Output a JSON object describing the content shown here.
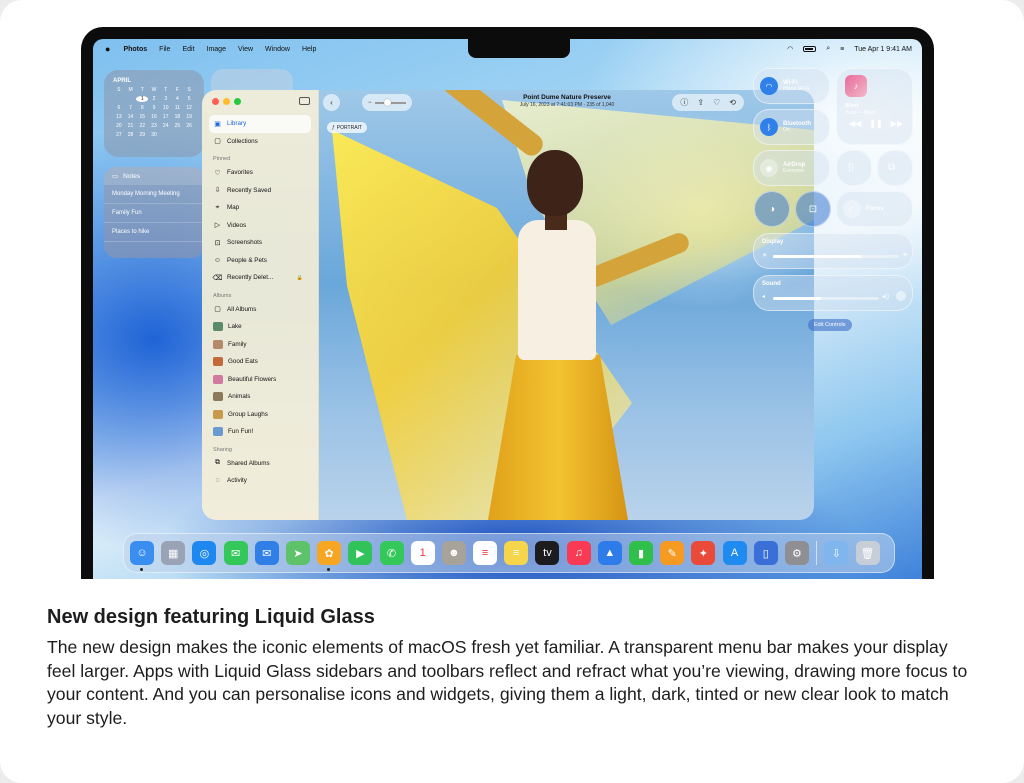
{
  "menubar": {
    "app": "Photos",
    "items": [
      "File",
      "Edit",
      "Image",
      "View",
      "Window",
      "Help"
    ],
    "datetime": "Tue Apr 1  9:41 AM"
  },
  "calendar_widget": {
    "month": "APRIL",
    "weekdays": [
      "S",
      "M",
      "T",
      "W",
      "T",
      "F",
      "S"
    ],
    "days": [
      "",
      "",
      "1",
      "2",
      "3",
      "4",
      "5",
      "6",
      "7",
      "8",
      "9",
      "10",
      "11",
      "12",
      "13",
      "14",
      "15",
      "16",
      "17",
      "18",
      "19",
      "20",
      "21",
      "22",
      "23",
      "24",
      "25",
      "26",
      "27",
      "28",
      "29",
      "30",
      "",
      "",
      ""
    ],
    "today": "1"
  },
  "notes_widget": {
    "title": "Notes",
    "items": [
      "Monday Morning Meeting",
      "Family Fun",
      "Places to hike"
    ]
  },
  "photos": {
    "title": "Point Dume Nature Preserve",
    "subtitle": "July 16, 2023 at 7:41:03 PM  ·  235 of 1,040",
    "badge": "PORTRAIT",
    "sidebar": {
      "top": [
        {
          "label": "Library",
          "icon": "library-icon"
        },
        {
          "label": "Collections",
          "icon": "collections-icon"
        }
      ],
      "pinned_header": "Pinned",
      "pinned": [
        {
          "label": "Favorites",
          "icon": "heart-icon"
        },
        {
          "label": "Recently Saved",
          "icon": "download-icon"
        },
        {
          "label": "Map",
          "icon": "map-icon"
        },
        {
          "label": "Videos",
          "icon": "video-icon"
        },
        {
          "label": "Screenshots",
          "icon": "screenshot-icon"
        },
        {
          "label": "People & Pets",
          "icon": "person-icon"
        },
        {
          "label": "Recently Delet...",
          "icon": "trash-icon"
        }
      ],
      "albums_header": "Albums",
      "albums": [
        {
          "label": "All Albums",
          "icon": "album-icon"
        },
        {
          "label": "Lake",
          "color": "#5b8a6a"
        },
        {
          "label": "Family",
          "color": "#b48a6a"
        },
        {
          "label": "Good Eats",
          "color": "#c46a3a"
        },
        {
          "label": "Beautiful Flowers",
          "color": "#d07aa0"
        },
        {
          "label": "Animals",
          "color": "#8a7a5a"
        },
        {
          "label": "Group Laughs",
          "color": "#c69a4a"
        },
        {
          "label": "Fun Fun!",
          "color": "#6a9ad0"
        }
      ],
      "sharing_header": "Sharing",
      "sharing": [
        {
          "label": "Shared Albums",
          "icon": "shared-albums-icon"
        },
        {
          "label": "Activity",
          "icon": "activity-icon"
        }
      ]
    }
  },
  "control_center": {
    "wifi": {
      "title": "Wi-Fi",
      "subtitle": "Home Wi-Fi"
    },
    "bluetooth": {
      "title": "Bluetooth",
      "subtitle": "On"
    },
    "airdrop": {
      "title": "AirDrop",
      "subtitle": "Everyone"
    },
    "now_playing": {
      "title": "Blest",
      "artist": "Yuno — Blest"
    },
    "focus": "Focus",
    "display": {
      "label": "Display",
      "level": 0.7
    },
    "sound": {
      "label": "Sound",
      "level": 0.45
    },
    "edit_controls": "Edit Controls"
  },
  "dock": {
    "apps": [
      {
        "name": "finder",
        "color": "#3a8ef0",
        "glyph": "☺"
      },
      {
        "name": "launchpad",
        "color": "#9aa3b5",
        "glyph": "▦"
      },
      {
        "name": "safari",
        "color": "#1e88f0",
        "glyph": "◎"
      },
      {
        "name": "messages",
        "color": "#34c759",
        "glyph": "✉"
      },
      {
        "name": "mail",
        "color": "#2f7fe6",
        "glyph": "✉"
      },
      {
        "name": "maps",
        "color": "#5ec26a",
        "glyph": "➤"
      },
      {
        "name": "photos",
        "color": "#f6a623",
        "glyph": "✿"
      },
      {
        "name": "facetime",
        "color": "#32c25a",
        "glyph": "▶"
      },
      {
        "name": "phone",
        "color": "#34c759",
        "glyph": "✆"
      },
      {
        "name": "calendar",
        "color": "#ffffff",
        "glyph": "1"
      },
      {
        "name": "contacts",
        "color": "#a8a39a",
        "glyph": "☻"
      },
      {
        "name": "reminders",
        "color": "#ffffff",
        "glyph": "≡"
      },
      {
        "name": "notes",
        "color": "#f7d54a",
        "glyph": "≡"
      },
      {
        "name": "tv",
        "color": "#1c1c1e",
        "glyph": "tv"
      },
      {
        "name": "music",
        "color": "#fa3a55",
        "glyph": "♫"
      },
      {
        "name": "keynote",
        "color": "#2e7bea",
        "glyph": "▲"
      },
      {
        "name": "numbers",
        "color": "#2fbf4a",
        "glyph": "▮"
      },
      {
        "name": "pages",
        "color": "#f59a23",
        "glyph": "✎"
      },
      {
        "name": "games",
        "color": "#ea4a3a",
        "glyph": "✦"
      },
      {
        "name": "app-store",
        "color": "#1f8bf0",
        "glyph": "A"
      },
      {
        "name": "iphone-mirroring",
        "color": "#3a6fd8",
        "glyph": "▯"
      },
      {
        "name": "system-settings",
        "color": "#8e8e93",
        "glyph": "⚙"
      }
    ],
    "extras": [
      {
        "name": "downloads",
        "color": "#7fb6ee",
        "glyph": "⇩"
      },
      {
        "name": "trash",
        "color": "#c7ced8",
        "glyph": "🗑"
      }
    ]
  },
  "article": {
    "headline": "New design featuring Liquid Glass",
    "body": "The new design makes the iconic elements of macOS fresh yet familiar. A transparent menu bar makes your display feel larger. Apps with Liquid Glass sidebars and toolbars reflect and refract what you’re viewing, drawing more focus to your content. And you can personalise icons and widgets, giving them a light, dark, tinted or new clear look to match your style."
  }
}
